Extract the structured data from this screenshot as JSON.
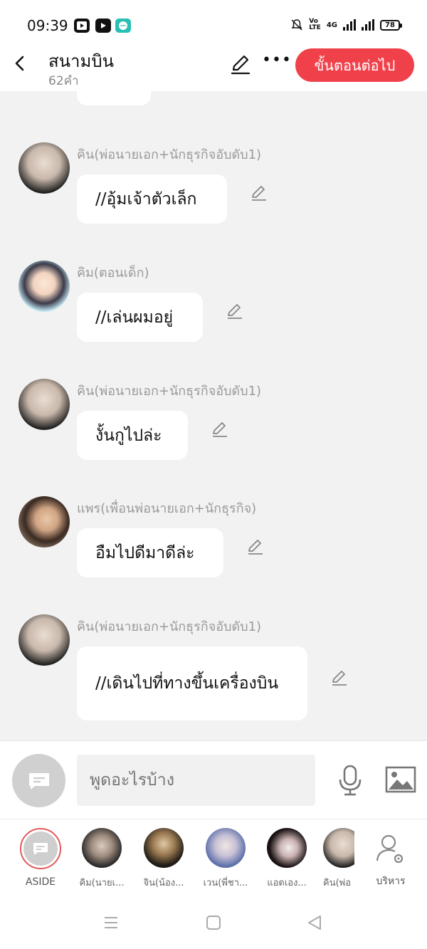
{
  "status_bar": {
    "time": "09:39",
    "battery": "78",
    "network": "4G"
  },
  "header": {
    "title": "สนามบิน",
    "word_count": "62คำ",
    "next_button": "ขั้นตอนต่อไป"
  },
  "messages": [
    {
      "sender": "คิน(พ่อนายเอก+นักธุรกิจอับดับ1)",
      "text": "//อุ้มเจ้าตัวเล็ก"
    },
    {
      "sender": "คิม(ตอนเด็ก)",
      "text": "//เล่นผมอยู่"
    },
    {
      "sender": "คิน(พ่อนายเอก+นักธุรกิจอับดับ1)",
      "text": "งั้นกูไปล่ะ"
    },
    {
      "sender": "แพร(เพื่อนพ่อนายเอก+นักธุรกิจ)",
      "text": "อืมไปดีมาดีล่ะ"
    },
    {
      "sender": "คิน(พ่อนายเอก+นักธุรกิจอับดับ1)",
      "text": "//เดินไปที่ทางขึ้นเครื่องบิน"
    }
  ],
  "input": {
    "placeholder": "พูดอะไรบ้าง"
  },
  "characters": [
    {
      "label": "ASIDE"
    },
    {
      "label": "คิม(นายเ..."
    },
    {
      "label": "จิน(น้อง..."
    },
    {
      "label": "เวน(พี่ชา..."
    },
    {
      "label": "แอดเอง..."
    },
    {
      "label": "คิน(พ่อ"
    },
    {
      "label": "บริหาร"
    }
  ],
  "icons": {
    "back": "chevron-left-icon",
    "edit": "pencil-icon",
    "more": "more-horizontal-icon",
    "mic": "microphone-icon",
    "image": "image-icon",
    "manage": "user-settings-icon"
  },
  "colors": {
    "accent": "#f0414b",
    "background": "#f2f2f2"
  }
}
